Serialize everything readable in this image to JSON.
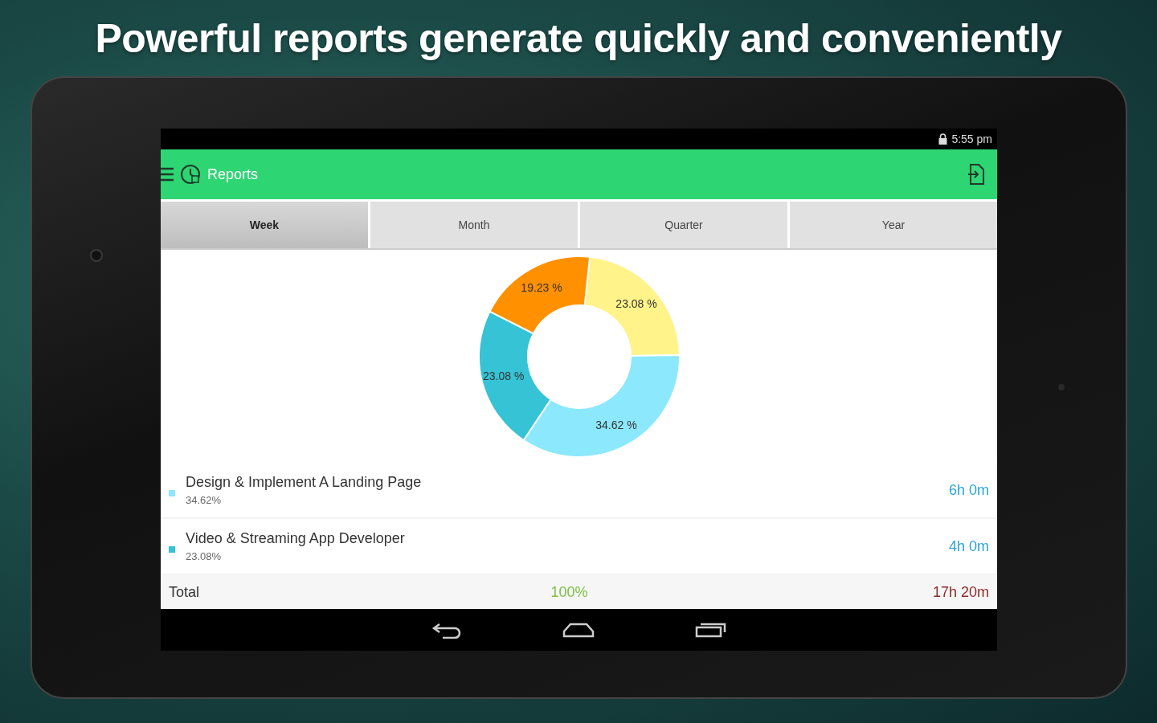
{
  "headline": "Powerful reports generate quickly and conveniently",
  "status_bar": {
    "time": "5:55 pm"
  },
  "app_bar": {
    "title": "Reports"
  },
  "tabs": [
    {
      "label": "Week",
      "selected": true
    },
    {
      "label": "Month",
      "selected": false
    },
    {
      "label": "Quarter",
      "selected": false
    },
    {
      "label": "Year",
      "selected": false
    }
  ],
  "chart_data": {
    "type": "donut",
    "values": [
      23.08,
      34.62,
      23.08,
      19.23
    ],
    "colors": [
      "#fff38a",
      "#8ce8fc",
      "#35c3d5",
      "#ff9000"
    ],
    "value_labels": [
      "23.08 %",
      "34.62 %",
      "23.08 %",
      "19.23 %"
    ]
  },
  "projects": [
    {
      "name": "Design & Implement A Landing Page",
      "percent": "34.62%",
      "duration": "6h 0m",
      "color": "#8ce8fc"
    },
    {
      "name": "Video & Streaming App Developer",
      "percent": "23.08%",
      "duration": "4h 0m",
      "color": "#35c3d5"
    }
  ],
  "total": {
    "label": "Total",
    "percent": "100%",
    "duration": "17h 20m"
  }
}
